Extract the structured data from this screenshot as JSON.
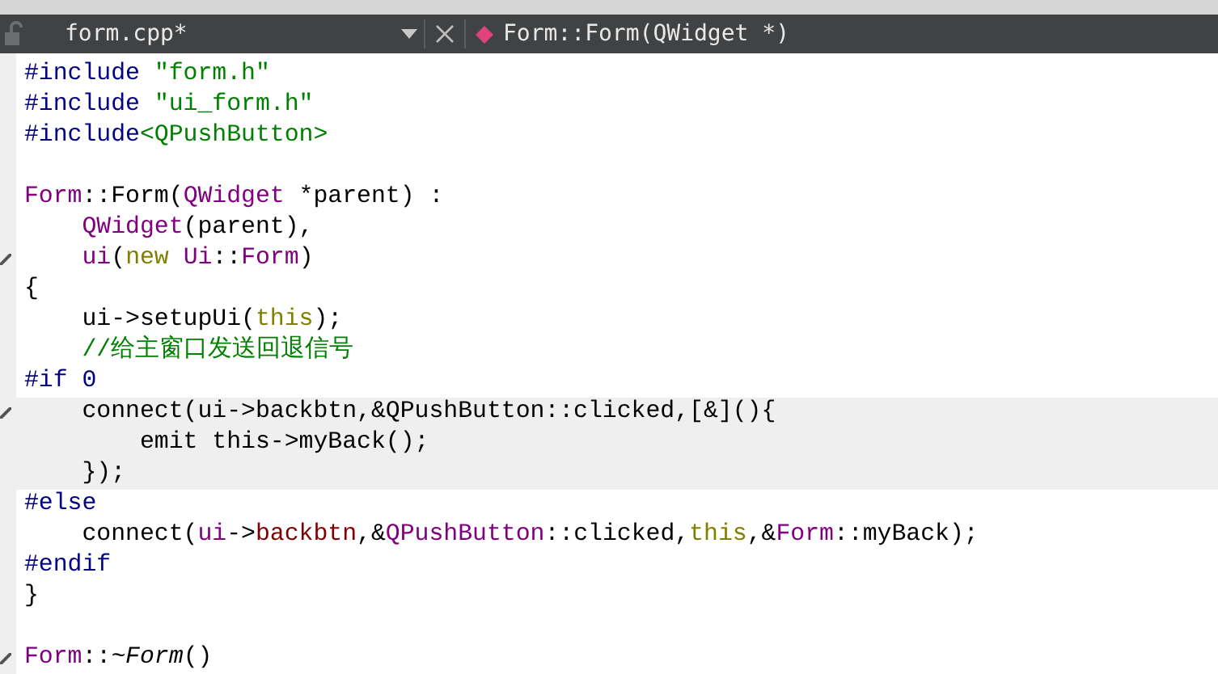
{
  "editor_tab": {
    "file": "form.cpp*",
    "symbol": "Form::Form(QWidget *)"
  },
  "code": {
    "lines": [
      {
        "marker": false,
        "highlighted": false,
        "tokens": [
          {
            "kind": "preproc",
            "text": "#include "
          },
          {
            "kind": "string",
            "text": "\"form.h\""
          }
        ]
      },
      {
        "marker": false,
        "highlighted": false,
        "tokens": [
          {
            "kind": "preproc",
            "text": "#include "
          },
          {
            "kind": "string",
            "text": "\"ui_form.h\""
          }
        ]
      },
      {
        "marker": false,
        "highlighted": false,
        "tokens": [
          {
            "kind": "preproc",
            "text": "#include"
          },
          {
            "kind": "string",
            "text": "<QPushButton>"
          }
        ]
      },
      {
        "marker": false,
        "highlighted": false
      },
      {
        "marker": false,
        "highlighted": false,
        "tokens": [
          {
            "kind": "type",
            "text": "Form"
          },
          {
            "kind": "plain",
            "text": "::Form("
          },
          {
            "kind": "type",
            "text": "QWidget"
          },
          {
            "kind": "plain",
            "text": " *parent) :"
          }
        ]
      },
      {
        "marker": false,
        "highlighted": false,
        "tokens": [
          {
            "kind": "type",
            "text": "    QWidget"
          },
          {
            "kind": "plain",
            "text": "(parent),"
          }
        ]
      },
      {
        "marker": true,
        "highlighted": false,
        "tokens": [
          {
            "kind": "type",
            "text": "    ui"
          },
          {
            "kind": "plain",
            "text": "("
          },
          {
            "kind": "keyword",
            "text": "new "
          },
          {
            "kind": "type",
            "text": "Ui"
          },
          {
            "kind": "plain",
            "text": "::"
          },
          {
            "kind": "type",
            "text": "Form"
          },
          {
            "kind": "plain",
            "text": ")"
          }
        ]
      },
      {
        "marker": false,
        "highlighted": false,
        "tokens": [
          {
            "kind": "plain",
            "text": "{"
          }
        ]
      },
      {
        "marker": false,
        "highlighted": false,
        "tokens": [
          {
            "kind": "plain",
            "text": "    ui->setupUi("
          },
          {
            "kind": "keyword",
            "text": "this"
          },
          {
            "kind": "plain",
            "text": ");"
          }
        ]
      },
      {
        "marker": false,
        "highlighted": false,
        "tokens": [
          {
            "kind": "comment",
            "text": "    //给主窗口发送回退信号"
          }
        ]
      },
      {
        "marker": false,
        "highlighted": false,
        "tokens": [
          {
            "kind": "preproc",
            "text": "#if 0"
          }
        ]
      },
      {
        "marker": true,
        "highlighted": true,
        "tokens": [
          {
            "kind": "plain",
            "text": "    connect(ui->backbtn,&QPushButton::clicked,[&](){"
          }
        ]
      },
      {
        "marker": false,
        "highlighted": true,
        "tokens": [
          {
            "kind": "plain",
            "text": "        emit this->myBack();"
          }
        ]
      },
      {
        "marker": false,
        "highlighted": true,
        "tokens": [
          {
            "kind": "plain",
            "text": "    });"
          }
        ]
      },
      {
        "marker": false,
        "highlighted": false,
        "tokens": [
          {
            "kind": "preproc",
            "text": "#else"
          }
        ]
      },
      {
        "marker": false,
        "highlighted": false,
        "tokens": [
          {
            "kind": "plain",
            "text": "    connect("
          },
          {
            "kind": "type",
            "text": "ui"
          },
          {
            "kind": "plain",
            "text": "->"
          },
          {
            "kind": "member",
            "text": "backbtn"
          },
          {
            "kind": "plain",
            "text": ",&"
          },
          {
            "kind": "type",
            "text": "QPushButton"
          },
          {
            "kind": "plain",
            "text": "::clicked,"
          },
          {
            "kind": "keyword",
            "text": "this"
          },
          {
            "kind": "plain",
            "text": ",&"
          },
          {
            "kind": "type",
            "text": "Form"
          },
          {
            "kind": "plain",
            "text": "::myBack);"
          }
        ]
      },
      {
        "marker": false,
        "highlighted": false,
        "tokens": [
          {
            "kind": "preproc",
            "text": "#endif"
          }
        ]
      },
      {
        "marker": false,
        "highlighted": false,
        "tokens": [
          {
            "kind": "plain",
            "text": "}"
          }
        ]
      },
      {
        "marker": false,
        "highlighted": false
      },
      {
        "marker": true,
        "highlighted": false,
        "tokens": [
          {
            "kind": "type",
            "text": "Form"
          },
          {
            "kind": "plain",
            "text": "::"
          },
          {
            "kind": "italic",
            "text": "~Form"
          },
          {
            "kind": "plain",
            "text": "()"
          }
        ]
      }
    ]
  }
}
